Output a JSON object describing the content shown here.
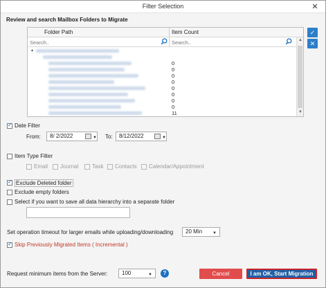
{
  "window": {
    "title": "Filter Selection",
    "close_glyph": "✕"
  },
  "heading": "Review and search Mailbox Folders to Migrate",
  "tree": {
    "col_folder": "Folder Path",
    "col_count": "Item Count",
    "search_placeholder_path": "Search..",
    "search_placeholder_count": "Search..",
    "expander": "▴",
    "counts": [
      "0",
      "0",
      "0",
      "0",
      "0",
      "0",
      "0",
      "0",
      "11"
    ]
  },
  "side_buttons": {
    "check": "✓",
    "clear": "✕"
  },
  "date_filter": {
    "label": "Date Filter",
    "checked": true,
    "from_label": "From:",
    "from_value": "8/ 2/2022",
    "to_label": "To:",
    "to_value": "8/12/2022"
  },
  "item_type_filter": {
    "label": "Item Type Filter",
    "checked": false,
    "options": [
      "Email",
      "Journal",
      "Task",
      "Contacts",
      "Calendar/Appointment"
    ]
  },
  "options": {
    "exclude_deleted": {
      "label": "Exclude Deleted folder",
      "checked": true
    },
    "exclude_empty": {
      "label": "Exclude empty folders",
      "checked": false
    },
    "save_hierarchy": {
      "label": "Select if you want to save all data hierarchy into a separate folder",
      "checked": false
    },
    "hierarchy_folder_value": ""
  },
  "timeout": {
    "label": "Set operation timeout for larger emails while uploading/downloading",
    "value": "20 Min"
  },
  "skip_migrated": {
    "label": "Skip Previously Migrated Items ( Incremental )",
    "checked": true
  },
  "request_min": {
    "label": "Request minimum items from the Server:",
    "value": "100",
    "help": "?"
  },
  "buttons": {
    "cancel": "Cancel",
    "start": "I am OK, Start Migration"
  },
  "colors": {
    "accent": "#1f5fa6",
    "cancel": "#e14c4c",
    "highlight_border": "#c8232b",
    "skip_label": "#c0392b"
  }
}
